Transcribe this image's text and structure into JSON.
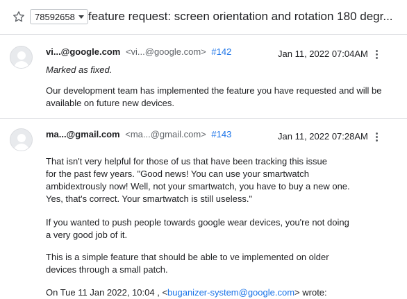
{
  "header": {
    "issue_id": "78592658",
    "title": "feature request: screen orientation and rotation 180 degr..."
  },
  "comments": [
    {
      "author": "vi...@google.com",
      "email": "<vi...@google.com>",
      "comment_number": "#142",
      "timestamp": "Jan 11, 2022 07:04AM",
      "status_line": "Marked as fixed.",
      "body": [
        "Our development team has implemented the feature you have requested and will be",
        "available on future new devices."
      ]
    },
    {
      "author": "ma...@gmail.com",
      "email": "<ma...@gmail.com>",
      "comment_number": "#143",
      "timestamp": "Jan 11, 2022 07:28AM",
      "paragraphs": [
        [
          "That isn't very helpful for those of us that have been tracking this issue",
          "for the past few years. \"Good news! You can use your smartwatch",
          "ambidextrously now! Well, not your smartwatch, you have to buy a new one.",
          "Yes, that's correct. Your smartwatch is still useless.\""
        ],
        [
          "If you wanted to push people towards google wear devices, you're not doing",
          "a very good job of it."
        ],
        [
          "This is a simple feature that should be able to ve implemented on older",
          "devices through a small patch."
        ]
      ],
      "quote_prefix": "On Tue 11 Jan 2022, 10:04 , <",
      "quote_email": "buganizer-system@google.com",
      "quote_suffix": "> wrote:"
    }
  ]
}
